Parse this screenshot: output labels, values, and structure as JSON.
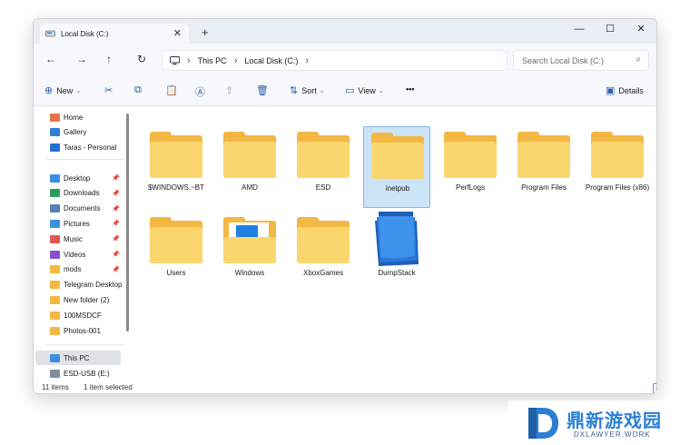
{
  "window": {
    "tab_title": "Local Disk (C:)",
    "tab_close": "✕",
    "new_tab": "+",
    "controls": {
      "minimize": "—",
      "maximize": "☐",
      "close": "✕"
    }
  },
  "nav": {
    "back": "←",
    "forward": "→",
    "up": "↑",
    "refresh": "↻",
    "breadcrumb": [
      "This PC",
      "Local Disk (C:)"
    ],
    "search_placeholder": "Search Local Disk (C:)"
  },
  "toolbar": {
    "new_label": "New",
    "sort_label": "Sort",
    "view_label": "View",
    "more_label": "•••",
    "details_label": "Details"
  },
  "sidebar": {
    "quick": [
      {
        "label": "Home",
        "icon": "home-icon",
        "color": "#e8734a"
      },
      {
        "label": "Gallery",
        "icon": "gallery-icon",
        "color": "#2f7fd8"
      },
      {
        "label": "Taras - Personal",
        "icon": "onedrive-icon",
        "color": "#1f6fd0"
      }
    ],
    "pinned": [
      {
        "label": "Desktop",
        "icon": "desktop-icon",
        "color": "#3a8ee6",
        "pinned": true
      },
      {
        "label": "Downloads",
        "icon": "downloads-icon",
        "color": "#2f9a5f",
        "pinned": true
      },
      {
        "label": "Documents",
        "icon": "documents-icon",
        "color": "#5a7fb8",
        "pinned": true
      },
      {
        "label": "Pictures",
        "icon": "pictures-icon",
        "color": "#3d8fdc",
        "pinned": true
      },
      {
        "label": "Music",
        "icon": "music-icon",
        "color": "#e0574f",
        "pinned": true
      },
      {
        "label": "Videos",
        "icon": "videos-icon",
        "color": "#8a4fd0",
        "pinned": true
      },
      {
        "label": "mods",
        "icon": "folder-icon",
        "color": "#f3b843",
        "pinned": true
      },
      {
        "label": "Telegram Desktop",
        "icon": "folder-icon",
        "color": "#f3b843",
        "pinned": false
      },
      {
        "label": "New folder (2)",
        "icon": "folder-icon",
        "color": "#f3b843",
        "pinned": false
      },
      {
        "label": "100MSDCF",
        "icon": "folder-icon",
        "color": "#f3b843",
        "pinned": false
      },
      {
        "label": "Photos-001",
        "icon": "folder-icon",
        "color": "#f3b843",
        "pinned": false
      }
    ],
    "pin_glyph": "📌",
    "this_pc": "This PC",
    "usb": "ESD-USB (E:)"
  },
  "files": [
    {
      "name": "$WINDOWS.~BT",
      "type": "folder",
      "selected": false
    },
    {
      "name": "AMD",
      "type": "folder",
      "selected": false
    },
    {
      "name": "ESD",
      "type": "folder",
      "selected": false
    },
    {
      "name": "inetpub",
      "type": "folder",
      "selected": true
    },
    {
      "name": "PerfLogs",
      "type": "folder",
      "selected": false
    },
    {
      "name": "Program Files",
      "type": "folder",
      "selected": false
    },
    {
      "name": "Program Files (x86)",
      "type": "folder",
      "selected": false
    },
    {
      "name": "Users",
      "type": "folder",
      "selected": false
    },
    {
      "name": "Windows",
      "type": "folder-windows",
      "selected": false
    },
    {
      "name": "XboxGames",
      "type": "folder",
      "selected": false
    },
    {
      "name": "DumpStack",
      "type": "file-blue",
      "selected": false
    }
  ],
  "status": {
    "item_count": "11 items",
    "selection": "1 item selected"
  },
  "watermark": {
    "title": "鼎新游戏园",
    "subtitle": "DXLAWYER.WORK"
  }
}
